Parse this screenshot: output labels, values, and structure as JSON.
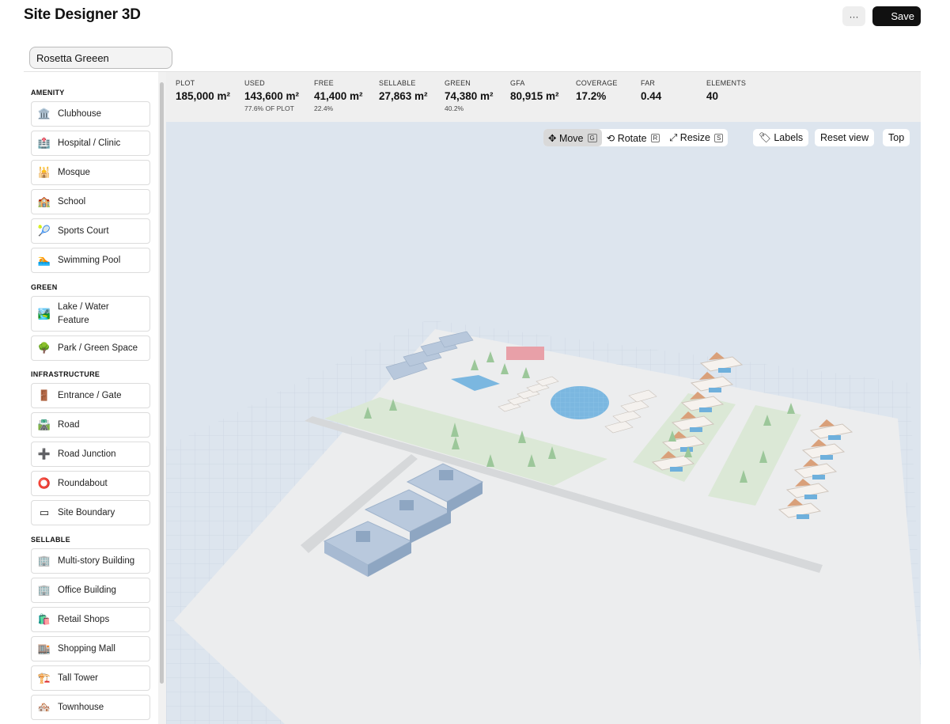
{
  "app": {
    "title": "Site Designer 3D",
    "more_label": "···",
    "save_label": "Save"
  },
  "project": {
    "name": "Rosetta Greeen"
  },
  "sidebar": {
    "sections": [
      {
        "label": "AMENITY",
        "items": [
          {
            "label": "Clubhouse",
            "icon": "🏛️",
            "icon_name": "clubhouse-icon"
          },
          {
            "label": "Hospital / Clinic",
            "icon": "🏥",
            "icon_name": "hospital-icon"
          },
          {
            "label": "Mosque",
            "icon": "🕌",
            "icon_name": "mosque-icon"
          },
          {
            "label": "School",
            "icon": "🏫",
            "icon_name": "school-icon"
          },
          {
            "label": "Sports Court",
            "icon": "🎾",
            "icon_name": "tennis-icon"
          },
          {
            "label": "Swimming Pool",
            "icon": "🏊",
            "icon_name": "swimmer-icon"
          }
        ]
      },
      {
        "label": "GREEN",
        "items": [
          {
            "label": "Lake / Water\nFeature",
            "icon": "🏞️",
            "icon_name": "lake-icon"
          },
          {
            "label": "Park / Green Space",
            "icon": "🌳",
            "icon_name": "tree-icon"
          }
        ]
      },
      {
        "label": "INFRASTRUCTURE",
        "items": [
          {
            "label": "Entrance / Gate",
            "icon": "🚪",
            "icon_name": "door-icon"
          },
          {
            "label": "Road",
            "icon": "🛣️",
            "icon_name": "road-icon"
          },
          {
            "label": "Road Junction",
            "icon": "➕",
            "icon_name": "junction-icon"
          },
          {
            "label": "Roundabout",
            "icon": "⭕",
            "icon_name": "roundabout-icon"
          },
          {
            "label": "Site Boundary",
            "icon": "▭",
            "icon_name": "boundary-icon"
          }
        ]
      },
      {
        "label": "SELLABLE",
        "items": [
          {
            "label": "Multi-story Building",
            "icon": "🏢",
            "icon_name": "building-icon"
          },
          {
            "label": "Office Building",
            "icon": "🏢",
            "icon_name": "office-icon"
          },
          {
            "label": "Retail Shops",
            "icon": "🛍️",
            "icon_name": "shopping-bags-icon"
          },
          {
            "label": "Shopping Mall",
            "icon": "🏬",
            "icon_name": "mall-icon"
          },
          {
            "label": "Tall Tower",
            "icon": "🏗️",
            "icon_name": "crane-icon"
          },
          {
            "label": "Townhouse",
            "icon": "🏘️",
            "icon_name": "townhouse-icon"
          }
        ]
      }
    ]
  },
  "stats": [
    {
      "key": "PLOT",
      "value": "185,000 m²",
      "sub": ""
    },
    {
      "key": "USED",
      "value": "143,600 m²",
      "sub": "77.6% OF PLOT"
    },
    {
      "key": "FREE",
      "value": "41,400 m²",
      "sub": "22.4%"
    },
    {
      "key": "SELLABLE",
      "value": "27,863 m²",
      "sub": ""
    },
    {
      "key": "GREEN",
      "value": "74,380 m²",
      "sub": "40.2%"
    },
    {
      "key": "GFA",
      "value": "80,915 m²",
      "sub": ""
    },
    {
      "key": "COVERAGE",
      "value": "17.2%",
      "sub": ""
    },
    {
      "key": "FAR",
      "value": "0.44",
      "sub": ""
    },
    {
      "key": "ELEMENTS",
      "value": "40",
      "sub": ""
    }
  ],
  "toolbar": {
    "move": {
      "label": "✥ Move",
      "key": "G"
    },
    "rotate": {
      "label": "⟲ Rotate",
      "key": "R"
    },
    "resize": {
      "label": "⤢ Resize",
      "key": "S"
    },
    "labels": "🏷 Labels",
    "reset": "Reset view",
    "top": "Top"
  }
}
